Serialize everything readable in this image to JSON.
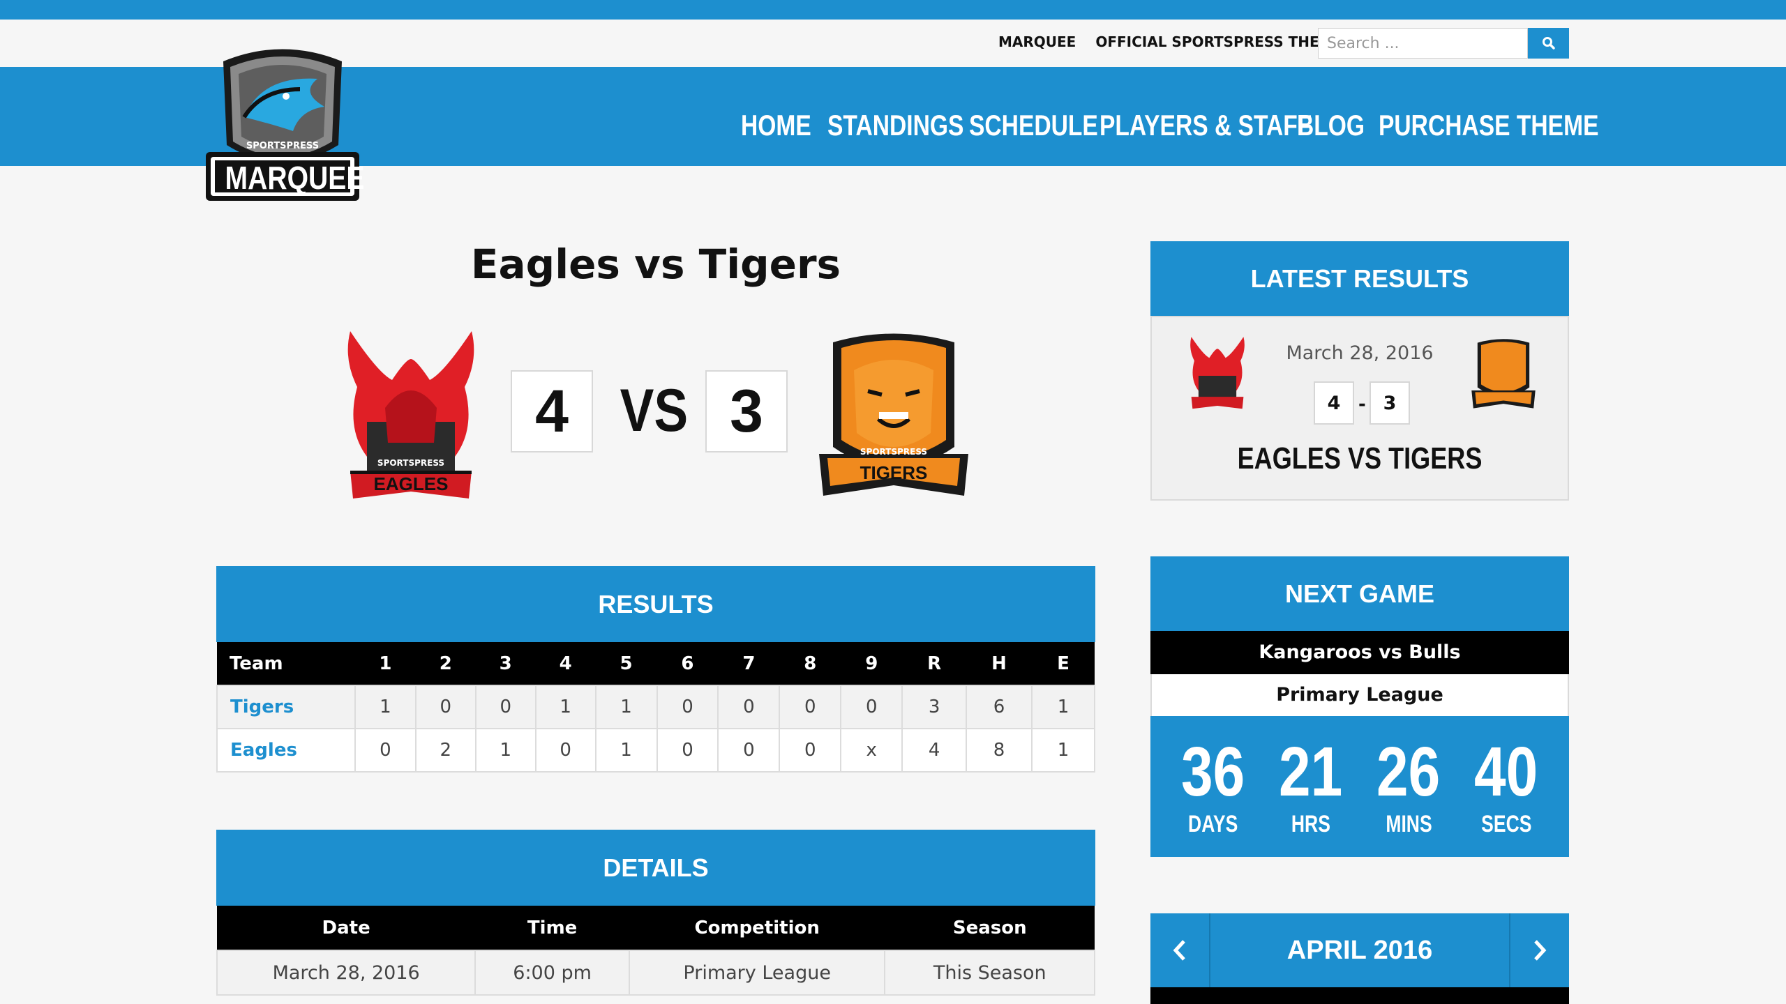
{
  "topbar": {
    "links": [
      "MARQUEE",
      "OFFICIAL SPORTSPRESS THEME"
    ],
    "search_placeholder": "Search ..."
  },
  "logo": {
    "top_text": "SPORTSPRESS",
    "main_text": "MARQUEE"
  },
  "nav": {
    "items": [
      "HOME",
      "STANDINGS",
      "SCHEDULE",
      "PLAYERS & STAFF",
      "BLOG",
      "PURCHASE THEME"
    ]
  },
  "match": {
    "title": "Eagles vs Tigers",
    "home_score": "4",
    "vs_label": "VS",
    "away_score": "3",
    "home_logo": {
      "top": "SPORTSPRESS",
      "name": "EAGLES"
    },
    "away_logo": {
      "top": "SPORTSPRESS",
      "name": "TIGERS"
    }
  },
  "results": {
    "heading": "RESULTS",
    "columns": [
      "Team",
      "1",
      "2",
      "3",
      "4",
      "5",
      "6",
      "7",
      "8",
      "9",
      "R",
      "H",
      "E"
    ],
    "rows": [
      {
        "team": "Tigers",
        "values": [
          "1",
          "0",
          "0",
          "1",
          "1",
          "0",
          "0",
          "0",
          "0",
          "3",
          "6",
          "1"
        ]
      },
      {
        "team": "Eagles",
        "values": [
          "0",
          "2",
          "1",
          "0",
          "1",
          "0",
          "0",
          "0",
          "x",
          "4",
          "8",
          "1"
        ]
      }
    ]
  },
  "details": {
    "heading": "DETAILS",
    "columns": [
      "Date",
      "Time",
      "Competition",
      "Season"
    ],
    "values": [
      "March 28, 2016",
      "6:00 pm",
      "Primary League",
      "This Season"
    ]
  },
  "latest_results": {
    "heading": "LATEST RESULTS",
    "date": "March 28, 2016",
    "home_score": "4",
    "dash": "-",
    "away_score": "3",
    "title": "EAGLES VS TIGERS"
  },
  "next_game": {
    "heading": "NEXT GAME",
    "matchup": "Kangaroos vs Bulls",
    "league": "Primary League",
    "countdown": [
      {
        "num": "36",
        "label": "DAYS"
      },
      {
        "num": "21",
        "label": "HRS"
      },
      {
        "num": "26",
        "label": "MINS"
      },
      {
        "num": "40",
        "label": "SECS"
      }
    ]
  },
  "calendar": {
    "title": "APRIL 2016"
  },
  "colors": {
    "accent": "#1d8fcf",
    "header_dark": "#000000",
    "link": "#1d8fcf"
  }
}
